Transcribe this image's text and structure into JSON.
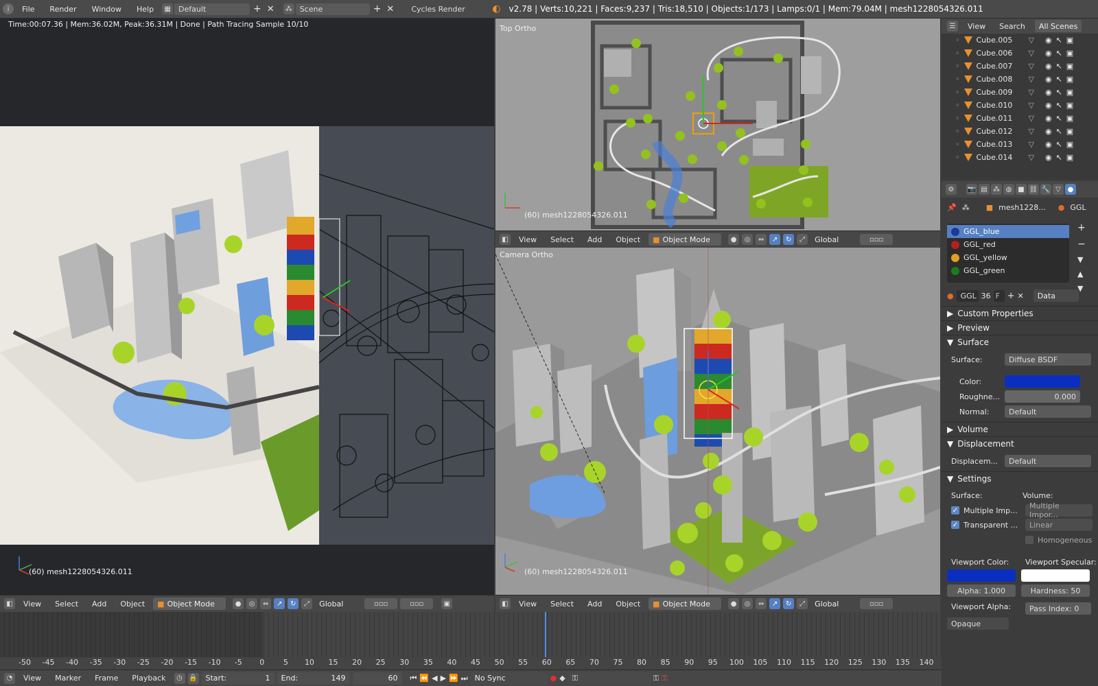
{
  "topbar": {
    "menus": [
      "File",
      "Render",
      "Window",
      "Help"
    ],
    "layout": "Default",
    "scene": "Scene",
    "engine": "Cycles Render",
    "stats": "v2.78 | Verts:10,221 | Faces:9,237 | Tris:18,510 | Objects:1/173 | Lamps:0/1 | Mem:79.04M | mesh1228054326.011"
  },
  "render_view": {
    "status": "Time:00:07.36 | Mem:36.02M, Peak:36.31M | Done | Path Tracing Sample 10/10",
    "object_label": "(60) mesh1228054326.011",
    "header": {
      "menus": [
        "View",
        "Select",
        "Add",
        "Object"
      ],
      "mode": "Object Mode",
      "orientation": "Global"
    }
  },
  "top_view": {
    "title": "Top Ortho",
    "object_label": "(60) mesh1228054326.011",
    "header": {
      "menus": [
        "View",
        "Select",
        "Add",
        "Object"
      ],
      "mode": "Object Mode",
      "orientation": "Global"
    }
  },
  "camera_view": {
    "title": "Camera Ortho",
    "object_label": "(60) mesh1228054326.011",
    "header": {
      "menus": [
        "View",
        "Select",
        "Add",
        "Object"
      ],
      "mode": "Object Mode",
      "orientation": "Global"
    }
  },
  "outliner": {
    "tabs": [
      "View",
      "Search",
      "All Scenes"
    ],
    "items": [
      "Cube.005",
      "Cube.006",
      "Cube.007",
      "Cube.008",
      "Cube.009",
      "Cube.010",
      "Cube.011",
      "Cube.012",
      "Cube.013",
      "Cube.014"
    ]
  },
  "properties": {
    "breadcrumb_object": "mesh1228...",
    "breadcrumb_material": "GGL",
    "materials": [
      {
        "name": "GGL_blue",
        "color": "#1a3a9a"
      },
      {
        "name": "GGL_red",
        "color": "#b81e1e"
      },
      {
        "name": "GGL_yellow",
        "color": "#e0a020"
      },
      {
        "name": "GGL_green",
        "color": "#1e7a1e"
      }
    ],
    "mat_name": "GGL",
    "users": "36",
    "fake_user": "F",
    "link": "Data",
    "panels": {
      "custom": "Custom Properties",
      "preview": "Preview",
      "surface": "Surface",
      "volume": "Volume",
      "displacement": "Displacement",
      "settings": "Settings"
    },
    "surface": {
      "surface_label": "Surface:",
      "surface_value": "Diffuse BSDF",
      "color_label": "Color:",
      "color_value": "#0a2fc0",
      "rough_label": "Roughne...",
      "rough_value": "0.000",
      "normal_label": "Normal:",
      "normal_value": "Default"
    },
    "displacement": {
      "label": "Displacem...",
      "value": "Default"
    },
    "settings": {
      "surface_col": "Surface:",
      "volume_col": "Volume:",
      "mis": "Multiple Imp...",
      "mis_volume": "Multiple Impor...",
      "transparent": "Transparent ...",
      "interp": "Linear",
      "homogeneous": "Homogeneous",
      "viewport_color": "Viewport Color:",
      "viewport_specular": "Viewport Specular:",
      "alpha": "Alpha:  1.000",
      "hardness": "Hardness:  50",
      "viewport_alpha": "Viewport Alpha:",
      "pass_index": "Pass Index:  0",
      "opaque": "Opaque"
    }
  },
  "timeline": {
    "ticks": [
      "-50",
      "-45",
      "-40",
      "-35",
      "-30",
      "-25",
      "-20",
      "-15",
      "-10",
      "-5",
      "0",
      "5",
      "10",
      "15",
      "20",
      "25",
      "30",
      "35",
      "40",
      "45",
      "50",
      "55",
      "60",
      "65",
      "70",
      "75",
      "80",
      "85",
      "90",
      "95",
      "100",
      "105",
      "110",
      "115",
      "120",
      "125",
      "130",
      "135",
      "140"
    ],
    "menus": [
      "View",
      "Marker",
      "Frame",
      "Playback"
    ],
    "start": "Start:",
    "start_value": "1",
    "end": "End:",
    "end_value": "149",
    "current": "60",
    "sync": "No Sync"
  }
}
